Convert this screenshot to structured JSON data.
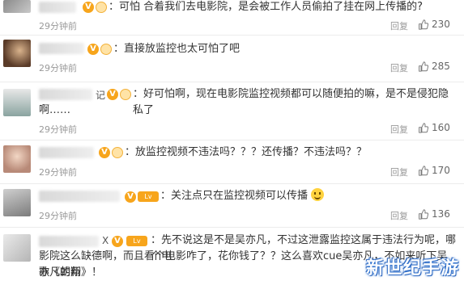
{
  "comments": [
    {
      "username_tail": "",
      "badge": "V",
      "text": "：可怕 合着我们去电影院，是会被工作人员偷拍了挂在网上传播的?",
      "time": "29分钟前",
      "reply_label": "回复",
      "likes": "230"
    },
    {
      "username_tail": "",
      "badge": "V",
      "text": "：直接放监控也太可怕了吧",
      "time": "29分钟前",
      "reply_label": "回复",
      "likes": "285"
    },
    {
      "username_tail": "记",
      "badge": "V",
      "text": "：好可怕啊，现在电影院监控视频都可以随便拍的嘛，是不是侵犯隐私了",
      "text_cont": "啊……",
      "time": "29分钟前",
      "reply_label": "回复",
      "likes": "160"
    },
    {
      "username_tail": "",
      "badge": "V",
      "text": "：放监控视频不违法吗？？？还传播？不违法吗？？",
      "time": "29分钟前",
      "reply_label": "回复",
      "likes": "170"
    },
    {
      "username_tail": "",
      "badge": "V",
      "text": "：关注点只在监控视频可以传播",
      "time": "29分钟前",
      "reply_label": "回复",
      "likes": "136"
    },
    {
      "username_tail": "X",
      "badge": "V",
      "text": "：先不说这是不是吴亦凡，不过这泄露监控这属于违法行为呢，哪个电",
      "text_cont": "影院这么缺德啊，而且看个电影咋了，花你钱了？？这么喜欢cue吴亦凡，不如来听下吴亦凡的新",
      "text_cont2": "歌《朝翔》！"
    }
  ],
  "watermark": "新世纪手游",
  "colors": {
    "badge": "#f7a51c",
    "meta": "#999999",
    "text": "#333333"
  }
}
